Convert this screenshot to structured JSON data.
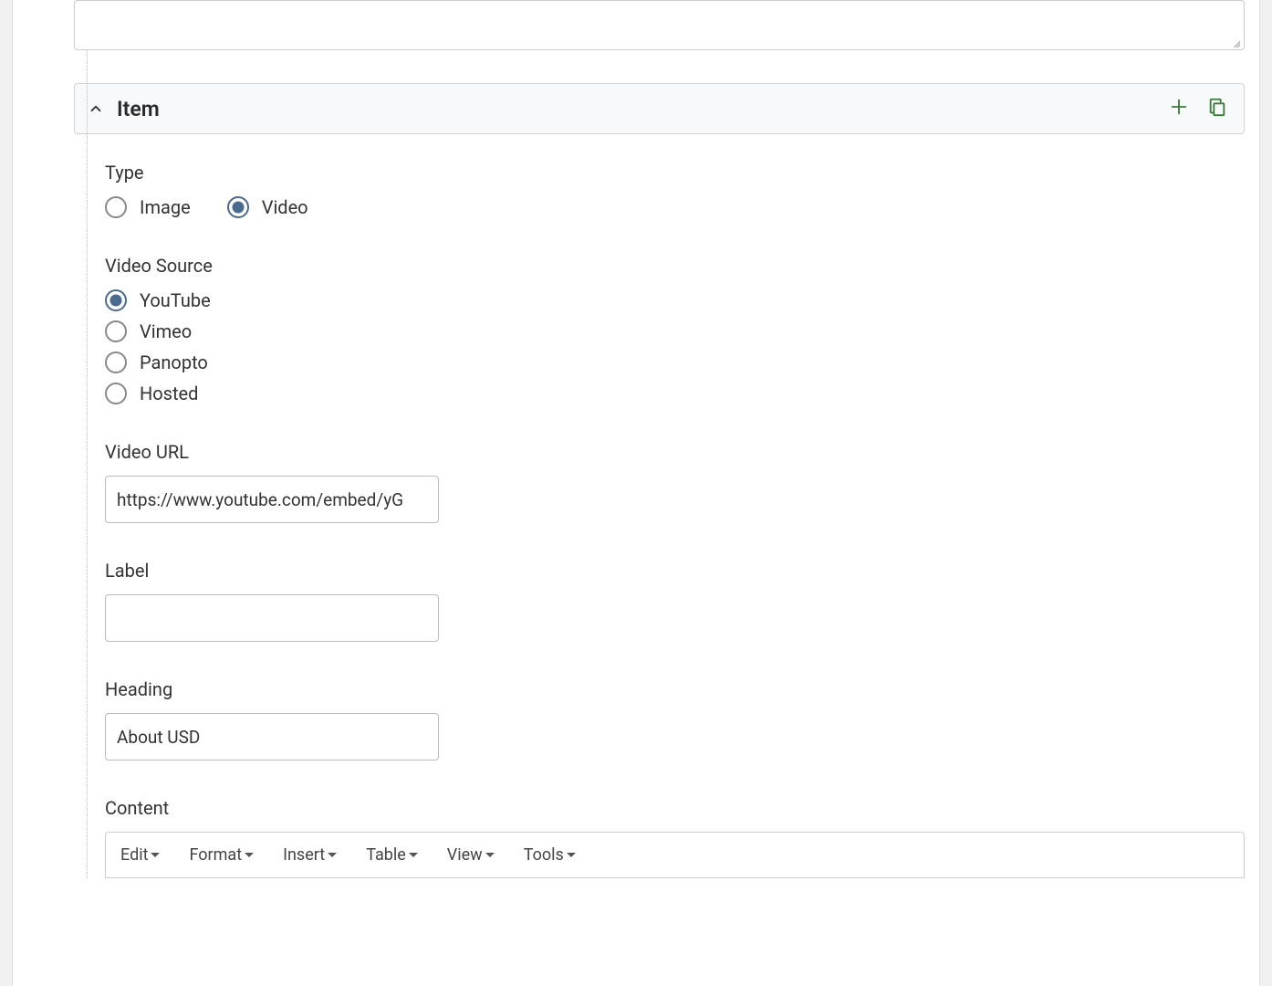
{
  "item": {
    "header_title": "Item"
  },
  "form": {
    "type_label": "Type",
    "type_options": {
      "image": "Image",
      "video": "Video"
    },
    "video_source_label": "Video Source",
    "video_source_options": {
      "youtube": "YouTube",
      "vimeo": "Vimeo",
      "panopto": "Panopto",
      "hosted": "Hosted"
    },
    "video_url_label": "Video URL",
    "video_url_value": "https://www.youtube.com/embed/yG",
    "label_label": "Label",
    "label_value": "",
    "heading_label": "Heading",
    "heading_value": "About USD",
    "content_label": "Content"
  },
  "editor": {
    "menus": {
      "edit": "Edit",
      "format": "Format",
      "insert": "Insert",
      "table": "Table",
      "view": "View",
      "tools": "Tools"
    }
  }
}
